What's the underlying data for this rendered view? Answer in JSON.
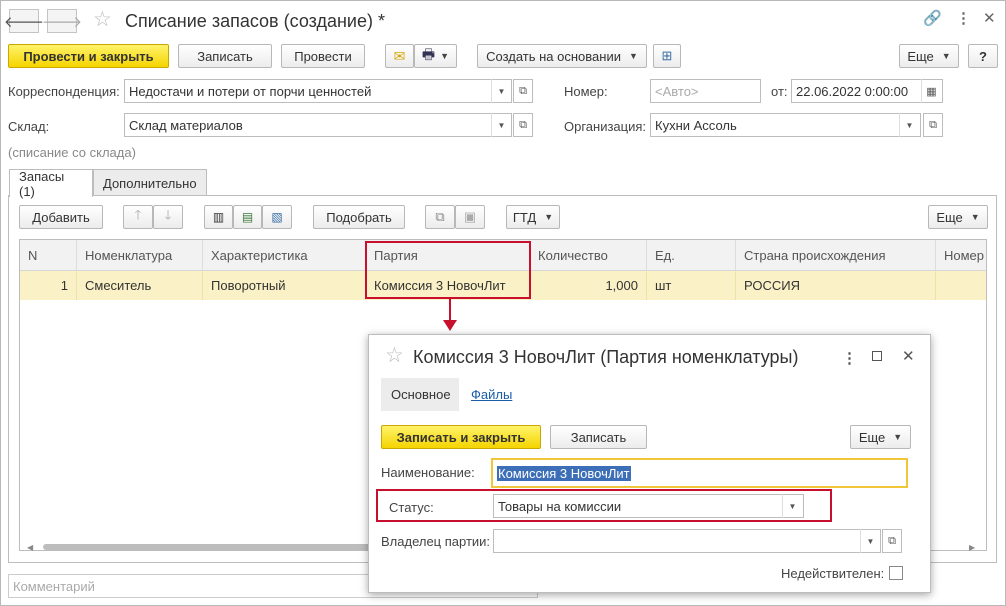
{
  "window": {
    "title": "Списание запасов (создание) *"
  },
  "toolbar": {
    "post_close": "Провести и закрыть",
    "save": "Записать",
    "post": "Провести",
    "create_based": "Создать на основании",
    "more": "Еще",
    "help": "?"
  },
  "form": {
    "correspondence_label": "Корреспонденция:",
    "correspondence_value": "Недостачи и потери от порчи ценностей",
    "number_label": "Номер:",
    "number_placeholder": "<Авто>",
    "date_label": "от:",
    "date_value": "22.06.2022  0:00:00",
    "warehouse_label": "Склад:",
    "warehouse_value": "Склад материалов",
    "org_label": "Организация:",
    "org_value": "Кухни Ассоль",
    "hint": "(списание со склада)"
  },
  "tabs": [
    {
      "label": "Запасы (1)"
    },
    {
      "label": "Дополнительно"
    }
  ],
  "table_toolbar": {
    "add": "Добавить",
    "pick": "Подобрать",
    "gtd": "ГТД",
    "more": "Еще"
  },
  "table": {
    "columns": [
      "N",
      "Номенклатура",
      "Характеристика",
      "Партия",
      "Количество",
      "Ед.",
      "Страна происхождения",
      "Номер"
    ],
    "rows": [
      [
        "1",
        "Смеситель",
        "Поворотный",
        "Комиссия 3 НовочЛит",
        "1,000",
        "шт",
        "РОССИЯ",
        ""
      ]
    ]
  },
  "comment": {
    "placeholder": "Комментарий"
  },
  "popup": {
    "title": "Комиссия 3 НовочЛит (Партия номенклатуры)",
    "tabs": [
      {
        "label": "Основное"
      },
      {
        "label": "Файлы"
      }
    ],
    "save_close": "Записать и закрыть",
    "save": "Записать",
    "more": "Еще",
    "name_label": "Наименование:",
    "name_value": "Комиссия 3 НовочЛит",
    "status_label": "Статус:",
    "status_value": "Товары на комиссии",
    "owner_label": "Владелец партии:",
    "owner_value": "",
    "inactive_label": "Недействителен:",
    "inactive_checked": false
  },
  "colors": {
    "accent_yellow": "#f5d400",
    "highlight_red": "#c8102e",
    "row_selected": "#fbf1c6",
    "link_blue": "#1a5ca8"
  }
}
